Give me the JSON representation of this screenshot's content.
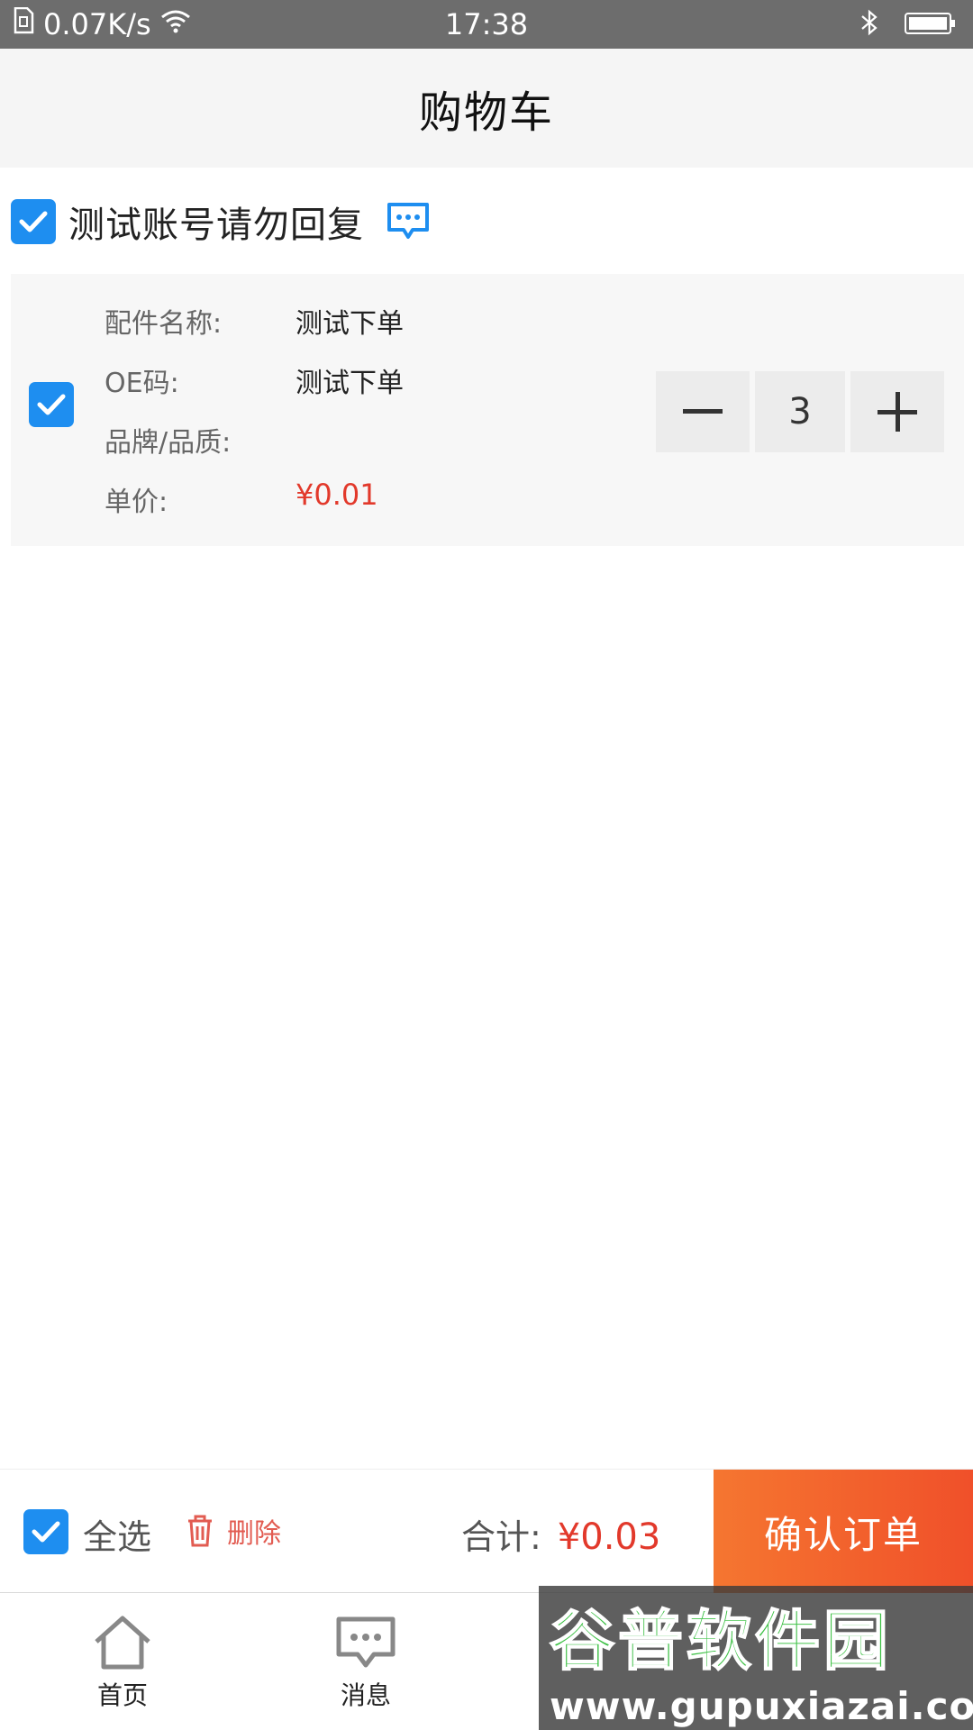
{
  "status_bar": {
    "network_speed": "0.07K/s",
    "time": "17:38",
    "icons": [
      "sim-icon",
      "wifi-icon",
      "bluetooth-icon",
      "battery-icon"
    ]
  },
  "header": {
    "title": "购物车"
  },
  "shop": {
    "name": "测试账号请勿回复",
    "checked": true,
    "icon": "chat-icon"
  },
  "item": {
    "checked": true,
    "fields": {
      "part_name_label": "配件名称:",
      "part_name_value": "测试下单",
      "oe_label": "OE码:",
      "oe_value": "测试下单",
      "brand_label": "品牌/品质:",
      "brand_value": "",
      "price_label": "单价:",
      "price_value": "¥0.01"
    },
    "quantity": "3",
    "minus_icon": "minus-icon",
    "plus_icon": "plus-icon"
  },
  "action_bar": {
    "select_all_label": "全选",
    "select_all_checked": true,
    "delete_label": "删除",
    "total_label": "合计:",
    "total_value": "¥0.03",
    "confirm_label": "确认订单"
  },
  "tabs": [
    {
      "label": "首页",
      "icon": "home-icon"
    },
    {
      "label": "消息",
      "icon": "message-icon"
    }
  ],
  "watermark": {
    "main": "谷普软件园",
    "sub": "www.gupuxiazai.com"
  },
  "colors": {
    "accent_blue": "#1e8ef0",
    "price_red": "#e2392b",
    "confirm_orange": "#f57630",
    "confirm_red": "#f0502a",
    "status_bar_bg": "#6d6d6d"
  }
}
